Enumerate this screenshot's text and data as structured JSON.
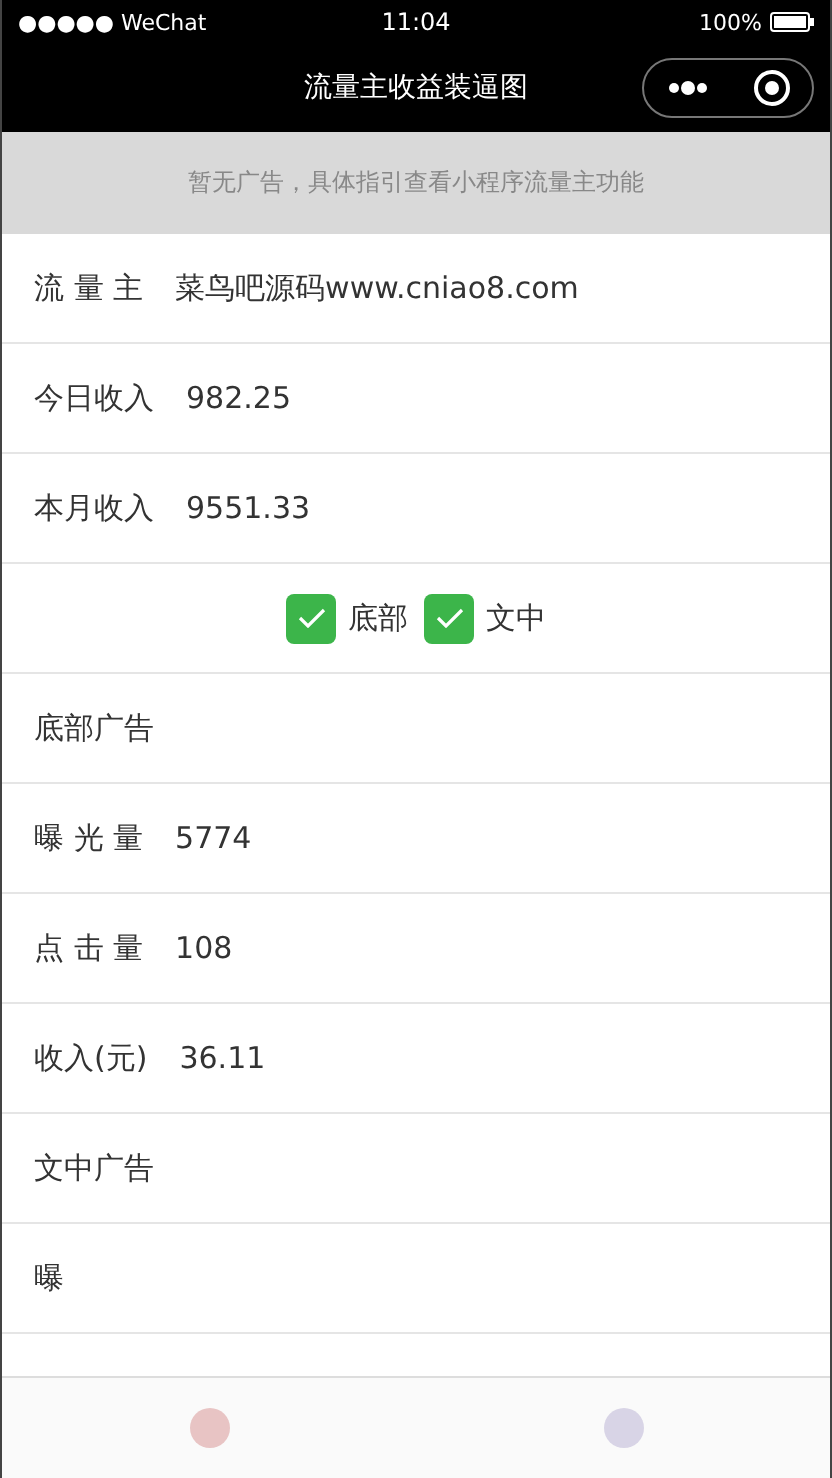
{
  "status_bar": {
    "carrier": "●●●●● WeChat",
    "time": "11:04",
    "battery": "100%"
  },
  "nav_bar": {
    "title": "流量主收益装逼图"
  },
  "ad_notice": "暂无广告，具体指引查看小程序流量主功能",
  "summary": [
    {
      "label": "流 量 主",
      "value": "菜鸟吧源码www.cniao8.com"
    },
    {
      "label": "今日收入",
      "value": "982.25"
    },
    {
      "label": "本月收入",
      "value": "9551.33"
    }
  ],
  "options": [
    {
      "label": "底部",
      "checked": true
    },
    {
      "label": "文中",
      "checked": true
    }
  ],
  "sections": [
    {
      "title": "底部广告",
      "rows": [
        {
          "label": "曝 光 量",
          "value": "5774"
        },
        {
          "label": "点 击 量",
          "value": "108"
        },
        {
          "label": "收入(元)",
          "value": "36.11"
        }
      ]
    },
    {
      "title": "文中广告",
      "rows": [
        {
          "label": "曝"
        }
      ]
    }
  ]
}
